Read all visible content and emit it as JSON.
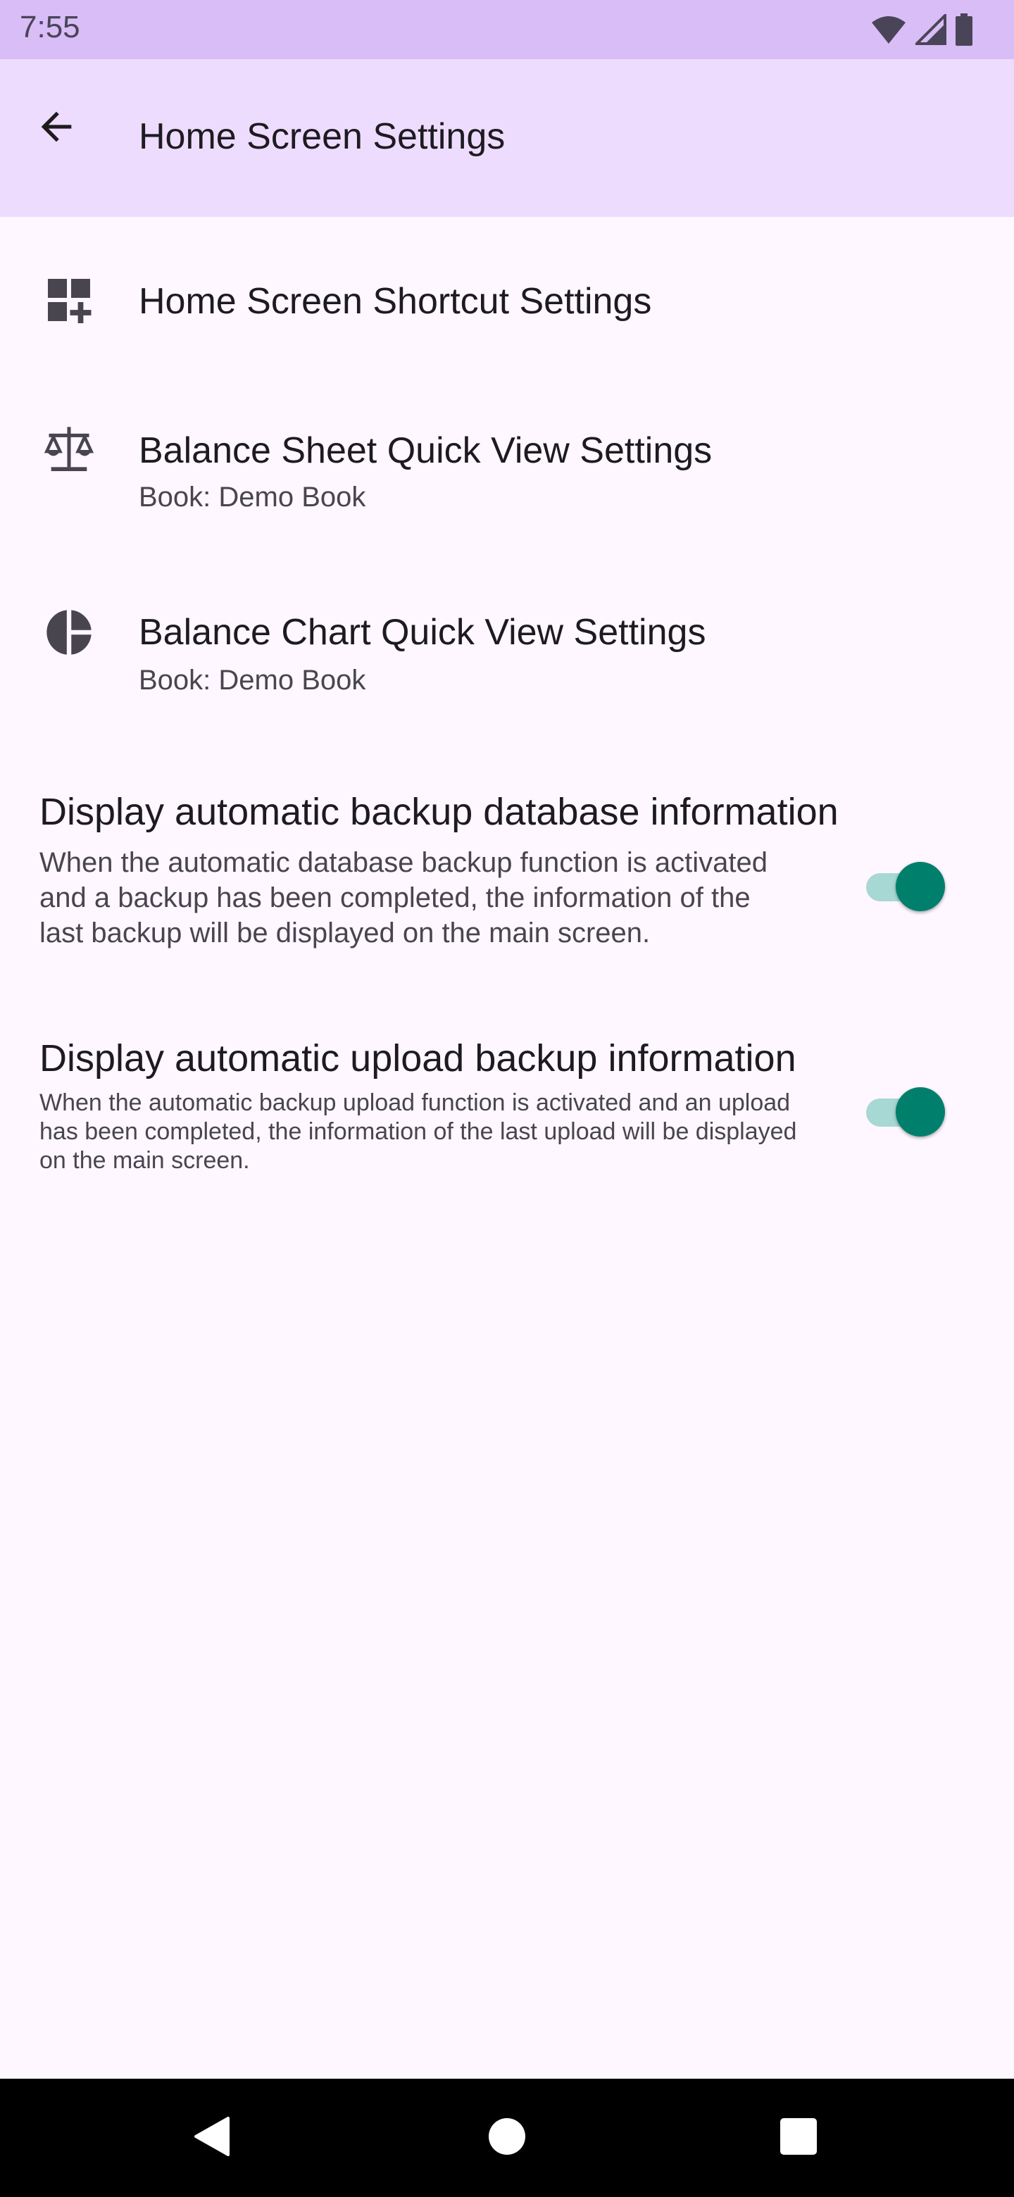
{
  "status_bar": {
    "time": "7:55",
    "icons": [
      "wifi-icon",
      "cellular-signal-icon",
      "battery-icon"
    ]
  },
  "app_bar": {
    "back_icon": "arrow-back-icon",
    "title": "Home Screen Settings"
  },
  "preferences": [
    {
      "icon": "dashboard-add-icon",
      "title": "Home Screen Shortcut Settings"
    },
    {
      "icon": "balance-scale-icon",
      "title": "Balance Sheet Quick View Settings",
      "summary": "Book: Demo Book"
    },
    {
      "icon": "pie-chart-icon",
      "title": "Balance Chart Quick View Settings",
      "summary": "Book: Demo Book"
    }
  ],
  "switches": [
    {
      "title": "Display automatic backup database information",
      "summary_lines": [
        "When the automatic database backup function is activated",
        "and a backup has been completed, the information of the",
        "last backup will be displayed on the main screen."
      ],
      "checked": true
    },
    {
      "title": "Display automatic upload backup information",
      "summary_lines": [
        "When the automatic backup upload function is activated and an upload",
        "has been completed, the information of the last upload will be displayed",
        "on the main screen."
      ],
      "checked": true
    }
  ],
  "nav_bar": {
    "icons": [
      "back-triangle-icon",
      "home-circle-icon",
      "recents-square-icon"
    ]
  },
  "colors": {
    "status_bar": "#d9bdf6",
    "app_bar": "#eedcff",
    "background": "#fef7ff",
    "switch_thumb": "#00806c",
    "switch_track": "#a8d8d3"
  }
}
